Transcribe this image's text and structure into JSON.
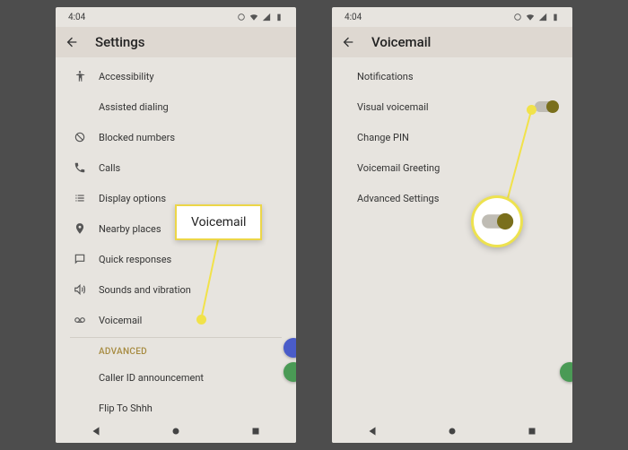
{
  "statusbar": {
    "time": "4:04"
  },
  "left": {
    "title": "Settings",
    "items": [
      {
        "label": "Accessibility"
      },
      {
        "label": "Assisted dialing"
      },
      {
        "label": "Blocked numbers"
      },
      {
        "label": "Calls"
      },
      {
        "label": "Display options"
      },
      {
        "label": "Nearby places"
      },
      {
        "label": "Quick responses"
      },
      {
        "label": "Sounds and vibration"
      },
      {
        "label": "Voicemail"
      }
    ],
    "section": "ADVANCED",
    "advanced": [
      {
        "label": "Caller ID announcement"
      },
      {
        "label": "Flip To Shhh"
      }
    ],
    "callout": "Voicemail"
  },
  "right": {
    "title": "Voicemail",
    "items": [
      {
        "label": "Notifications"
      },
      {
        "label": "Visual voicemail",
        "toggle": true
      },
      {
        "label": "Change PIN"
      },
      {
        "label": "Voicemail Greeting"
      },
      {
        "label": "Advanced Settings"
      }
    ]
  }
}
